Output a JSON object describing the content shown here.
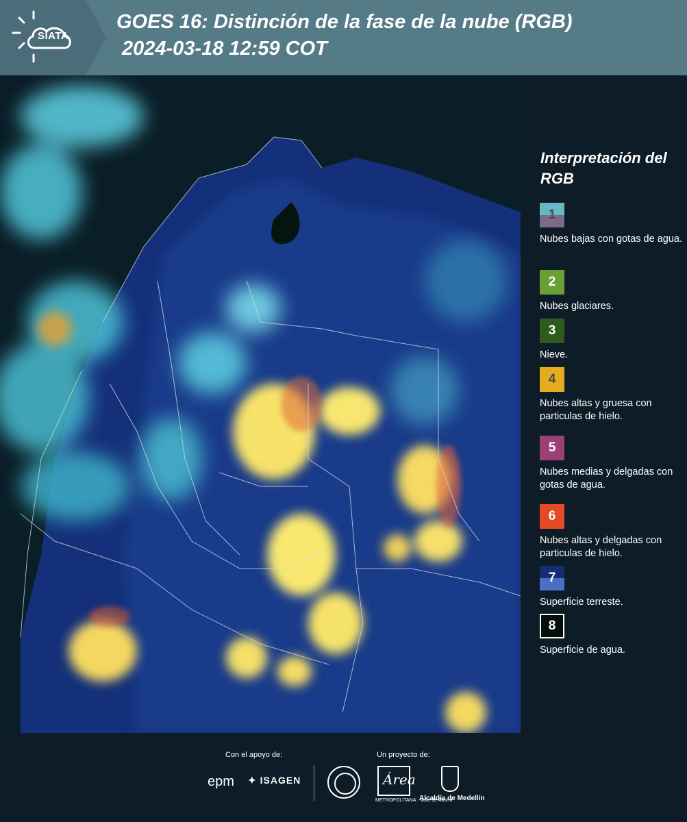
{
  "header": {
    "logo_text": "SIATA",
    "title_line1": "GOES 16: Distinción de la fase de la nube (RGB)",
    "title_line2": "2024-03-18 12:59 COT",
    "background_color": "#557b87"
  },
  "legend": {
    "title": "Interpretación del RGB",
    "items": [
      {
        "number": "1",
        "desc": "Nubes bajas con gotas de agua.",
        "color_top": "#66b8c4",
        "color_bottom": "#7f6a86",
        "number_color": "#4a4a55"
      },
      {
        "number": "2",
        "desc": "Nubes glaciares.",
        "color_top": "#6aa033",
        "color_bottom": "#6aa033",
        "number_color": "#ffffff"
      },
      {
        "number": "3",
        "desc": "Nieve.",
        "color_top": "#2e5a1c",
        "color_bottom": "#2e5a1c",
        "number_color": "#ffffff"
      },
      {
        "number": "4",
        "desc": "Nubes altas y gruesa con particulas de hielo.",
        "color_top": "#e6ac20",
        "color_bottom": "#e6ac20",
        "number_color": "#4a4a4a"
      },
      {
        "number": "5",
        "desc": "Nubes medias y delgadas con gotas de agua.",
        "color_top": "#9c3f76",
        "color_bottom": "#9c3f76",
        "number_color": "#ffffff"
      },
      {
        "number": "6",
        "desc": "Nubes altas y delgadas con particulas de hielo.",
        "color_top": "#e64a25",
        "color_bottom": "#e64a25",
        "number_color": "#ffffff"
      },
      {
        "number": "7",
        "desc": "Superficie terreste.",
        "color_top": "#142e74",
        "color_bottom": "#4a6fc4",
        "number_color": "#ffffff"
      },
      {
        "number": "8",
        "desc": "Superficie de agua.",
        "color_top": "#050f0a",
        "color_bottom": "#050f0a",
        "number_color": "#ffffff"
      }
    ]
  },
  "footer": {
    "support_label": "Con el apoyo de:",
    "project_label": "Un proyecto de:",
    "sponsor_epm": "epm",
    "sponsor_isagen": "ISAGEN",
    "area_script": "Área",
    "area_sub": "METROPOLITANA · Valle de Aburrá",
    "alcaldia": "Alcaldía de Medellín"
  }
}
